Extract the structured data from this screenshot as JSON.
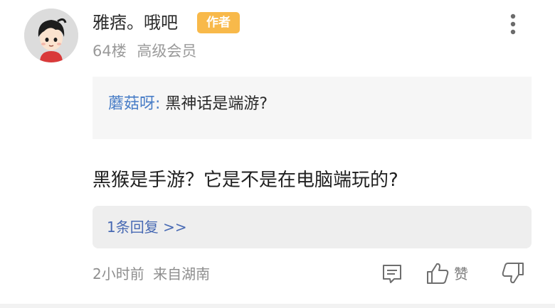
{
  "post": {
    "user": {
      "name": "雅痞。哦吧",
      "badge": "作者",
      "floor": "64楼",
      "level": "高级会员",
      "avatar_icon": "cartoon-avatar"
    },
    "quote": {
      "author": "蘑菇呀:",
      "text": "黑神话是端游?"
    },
    "content": "黑猴是手游？它是不是在电脑端玩的?",
    "replies_link": "1条回复 >>",
    "time": "2小时前",
    "location": "来自湖南",
    "actions": {
      "reply_icon": "comment-icon",
      "like_label": "赞",
      "like_icon": "thumbs-up-icon",
      "dislike_icon": "thumbs-down-icon",
      "more_icon": "more-vertical-icon"
    },
    "colors": {
      "badge": "#f8b94a",
      "quote_author": "#4a7ec7",
      "reply_link": "#4769b3",
      "muted_text": "#9a9a9a"
    }
  }
}
